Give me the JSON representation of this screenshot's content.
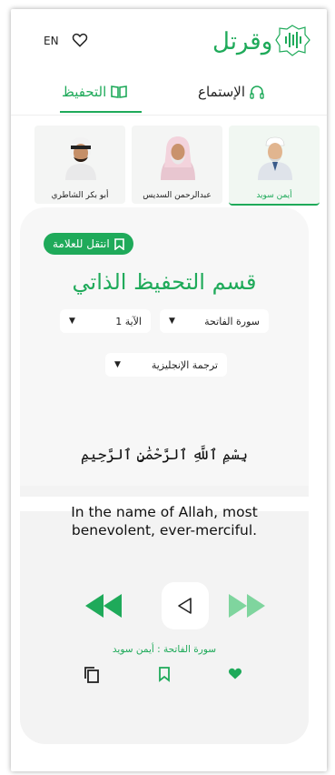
{
  "header": {
    "language": "EN",
    "logo_text": "وقرتل"
  },
  "tabs": [
    {
      "label": "التحفيظ",
      "active": true
    },
    {
      "label": "الإستماع",
      "active": false
    }
  ],
  "reciters": [
    {
      "name": "أيمن سويد",
      "active": true
    },
    {
      "name": "عبدالرحمن السديس",
      "active": false
    },
    {
      "name": "أبو بكر الشاطري",
      "active": false
    }
  ],
  "main": {
    "bookmark_button": "انتقل للعلامة",
    "title": "قسم التحفيظ الذاتي",
    "surah_select": "سورة الفاتحة",
    "ayah_select": "الآية 1",
    "translation_select": "ترجمة الإنجليزية",
    "arabic_text": "بِسْمِ ٱللَّهِ ٱلرَّحْمَٰنِ ٱلرَّحِيمِ",
    "english_line1": "In the name of Allah, most",
    "english_line2": "benevolent, ever-merciful.",
    "now_playing": "سورة الفاتحة : أيمن سويد"
  },
  "colors": {
    "accent": "#1faa5a",
    "accent_light": "#7fd59e"
  }
}
